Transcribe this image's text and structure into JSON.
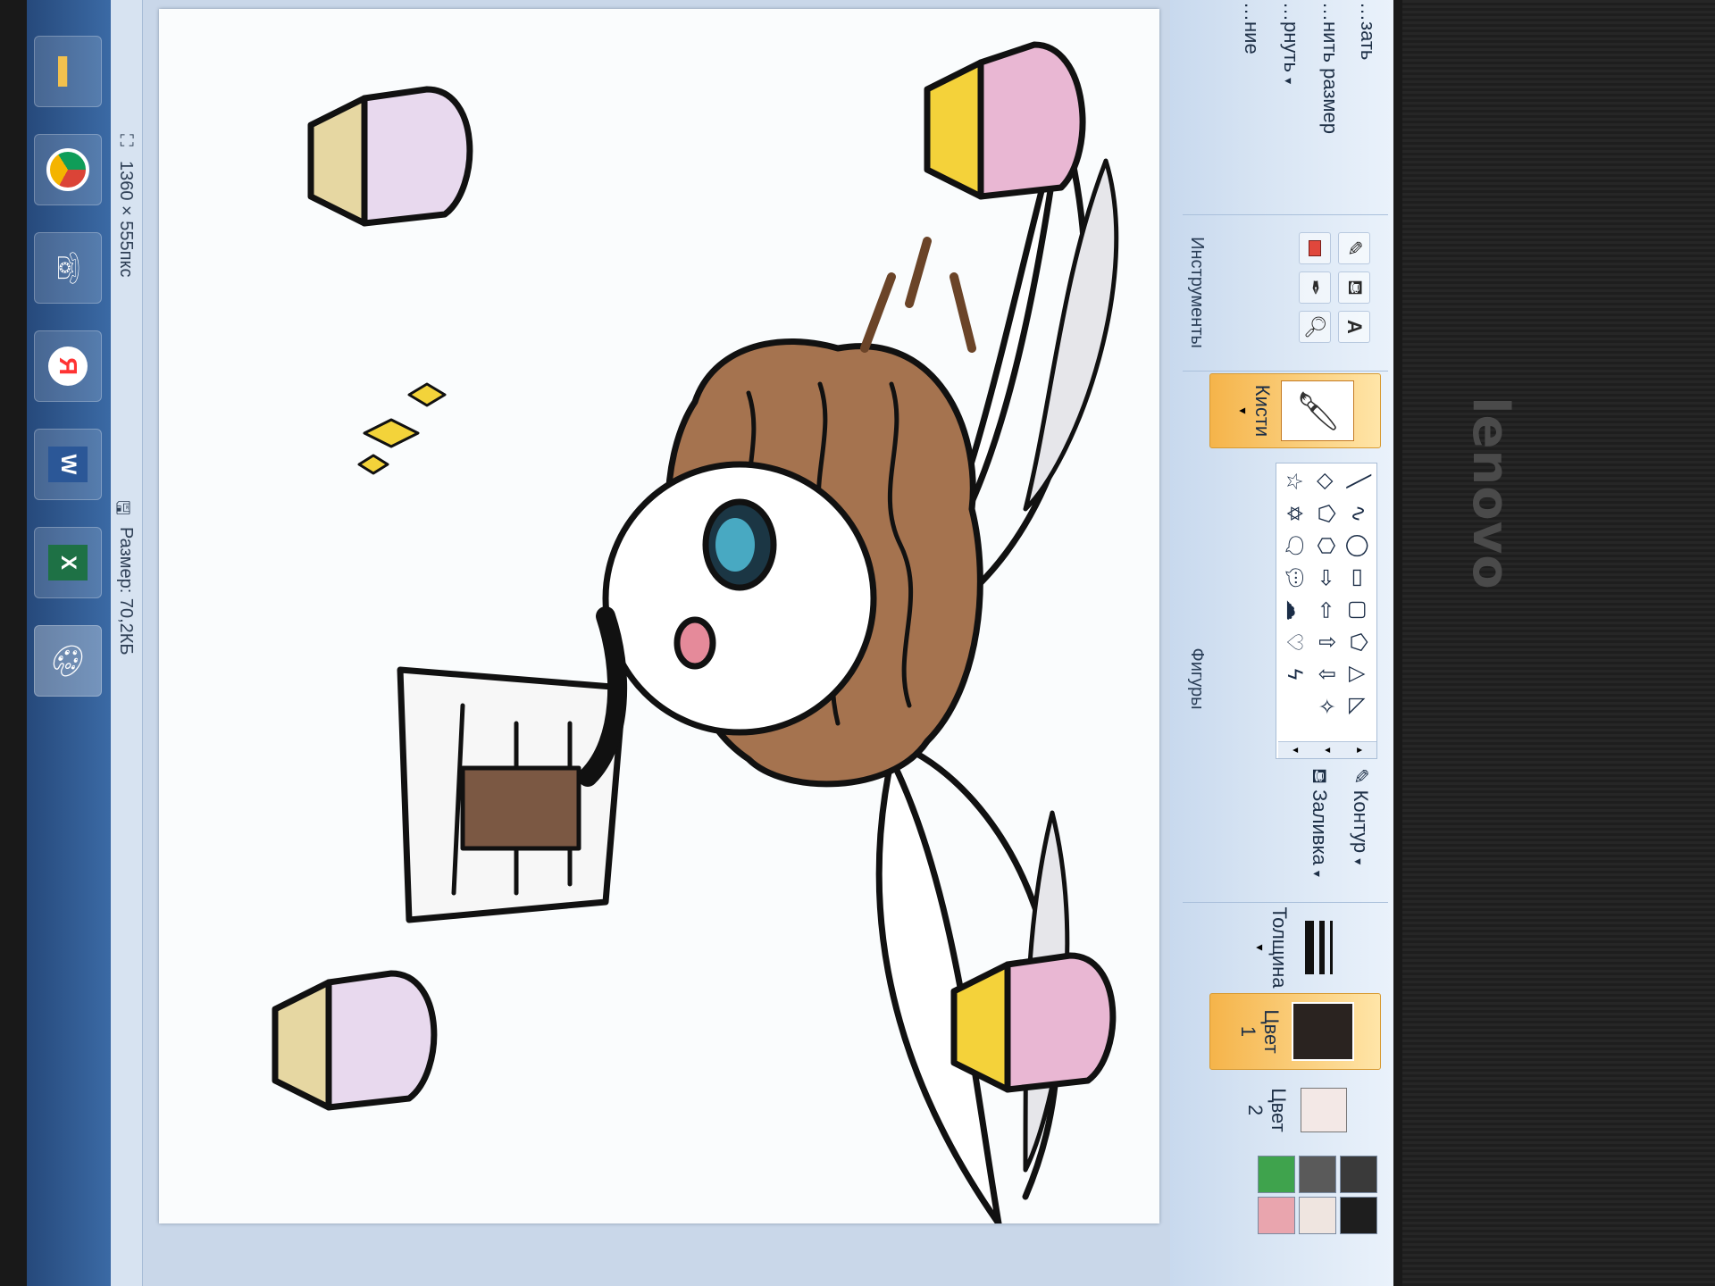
{
  "app": {
    "title": "Paint"
  },
  "ribbon": {
    "clipboard": {
      "paste": "…зать",
      "resize": "…нить размер",
      "rotate": "…рнуть",
      "select_label": "…ние"
    },
    "tools_label": "Инструменты",
    "brushes_label": "Кисти",
    "shapes_label": "Фигуры",
    "outline_label": "Контур",
    "fill_label": "Заливка",
    "thickness_label": "Толщина",
    "color1_label": "Цвет 1",
    "color2_label": "Цвет 2",
    "colors": {
      "color1": "#2a2320",
      "color2": "#f3e8e6",
      "palette": [
        "#3a3a3a",
        "#5a5a5a",
        "#3fa34d",
        "#1e1e1e",
        "#efe5e0",
        "#e9a5ae"
      ]
    }
  },
  "status": {
    "dimensions": "1360 × 555пкс",
    "size": "Размер: 70,2КБ"
  },
  "bezel": {
    "brand": "lenovo"
  },
  "taskbar": {
    "items": [
      "paint-icon",
      "excel-icon",
      "word-icon",
      "yandex-icon",
      "phone-icon",
      "chrome-icon",
      "folder-icon"
    ]
  }
}
